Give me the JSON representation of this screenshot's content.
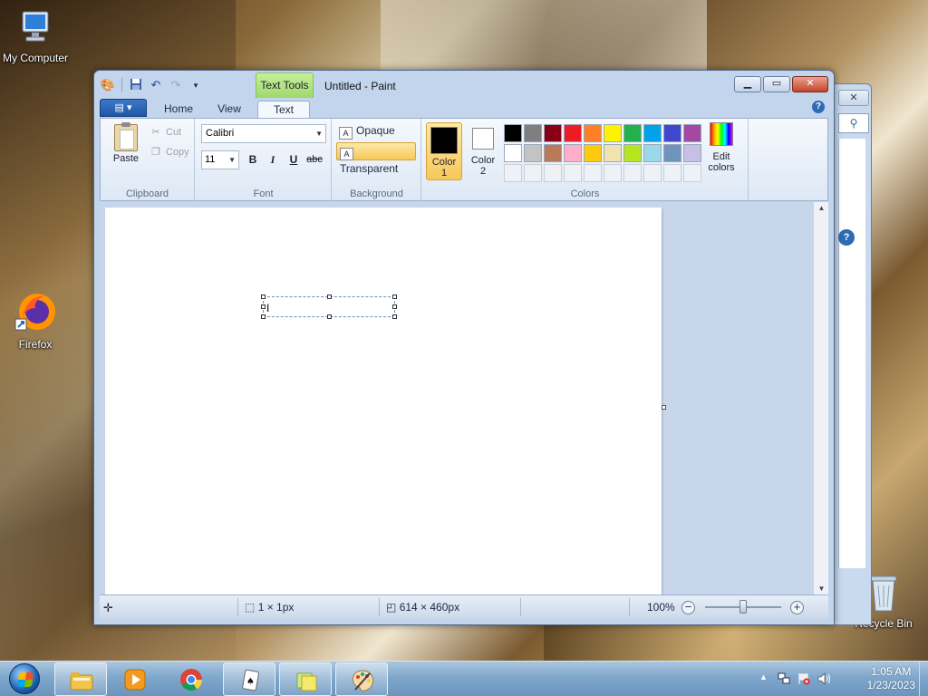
{
  "desktop": {
    "icons": [
      {
        "label": "My Computer"
      },
      {
        "label": "Firefox"
      },
      {
        "label": "Recycle Bin"
      }
    ]
  },
  "window": {
    "title": "Untitled - Paint",
    "context_tab": "Text Tools",
    "tabs": [
      "Home",
      "View",
      "Text"
    ],
    "active_tab": "Text"
  },
  "ribbon": {
    "clipboard": {
      "label": "Clipboard",
      "paste": "Paste",
      "cut": "Cut",
      "copy": "Copy"
    },
    "font": {
      "label": "Font",
      "family": "Calibri",
      "size": "11",
      "bold": "B",
      "italic": "I",
      "underline": "U",
      "strike": "abc"
    },
    "background": {
      "label": "Background",
      "opaque": "Opaque",
      "transparent": "Transparent",
      "selected": "Transparent"
    },
    "colors": {
      "label": "Colors",
      "color1_label": "Color",
      "color1_num": "1",
      "color2_label": "Color",
      "color2_num": "2",
      "color1": "#000000",
      "color2": "#ffffff",
      "edit": "Edit",
      "edit2": "colors",
      "palette_row1": [
        "#000000",
        "#7f7f7f",
        "#880015",
        "#ed1c24",
        "#ff7f27",
        "#fff200",
        "#22b14c",
        "#00a2e8",
        "#3f48cc",
        "#a349a4"
      ],
      "palette_row2": [
        "#ffffff",
        "#c3c3c3",
        "#b97a57",
        "#ffaec9",
        "#ffc90e",
        "#efe4b0",
        "#b5e61d",
        "#99d9ea",
        "#7092be",
        "#c8bfe7"
      ]
    }
  },
  "statusbar": {
    "selection": "1 × 1px",
    "canvas_size": "614 × 460px",
    "zoom": "100%"
  },
  "taskbar": {
    "clock_time": "1:05 AM",
    "clock_date": "1/23/2023"
  }
}
